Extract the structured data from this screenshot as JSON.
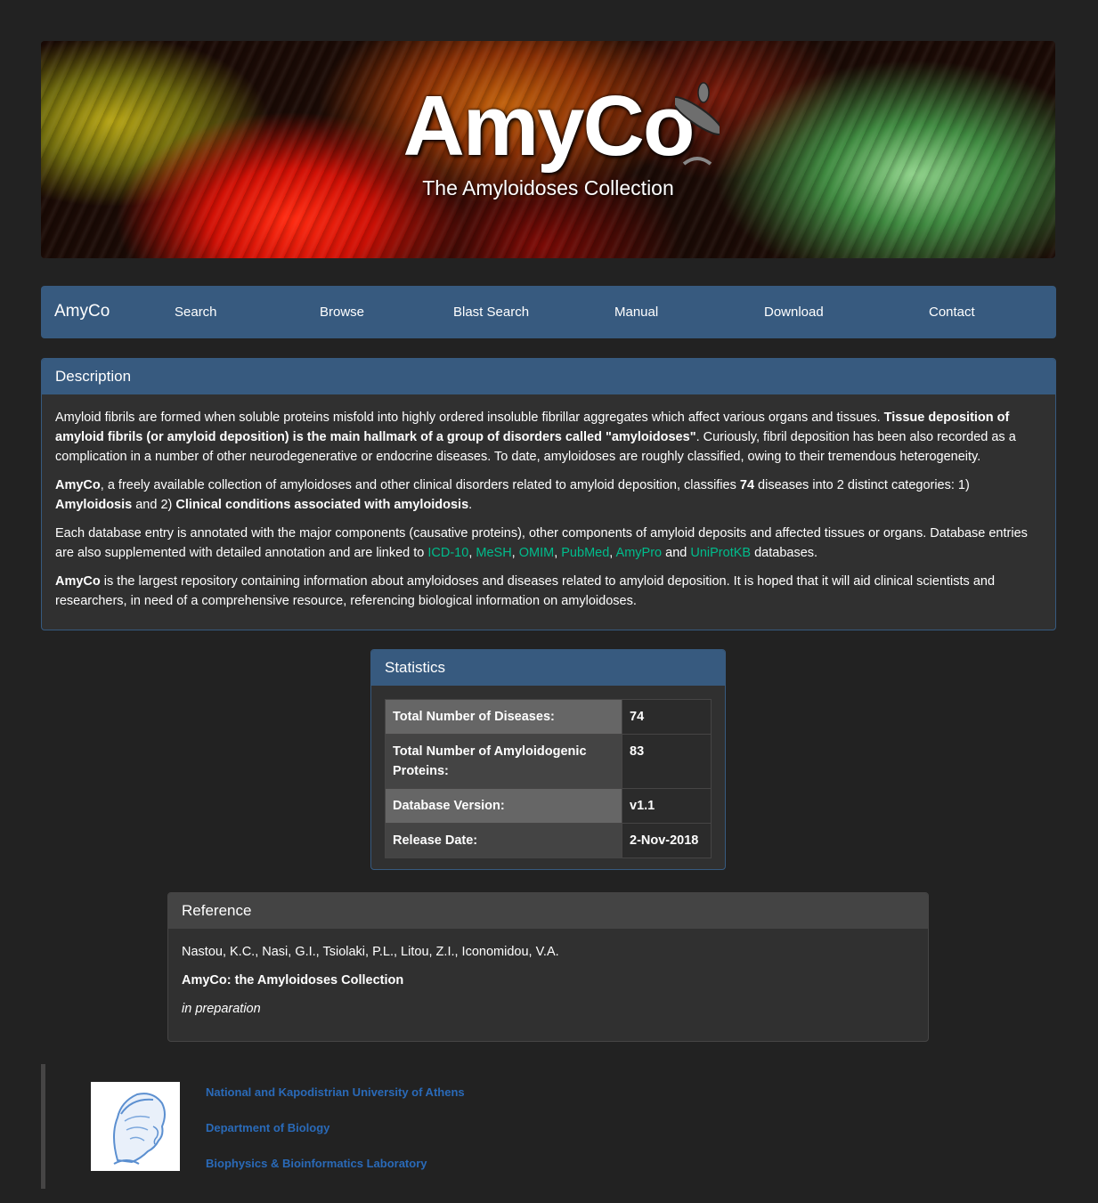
{
  "banner": {
    "title": "AmyCo",
    "subtitle": "The Amyloidoses Collection"
  },
  "navbar": {
    "brand": "AmyCo",
    "items": [
      "Search",
      "Browse",
      "Blast Search",
      "Manual",
      "Download",
      "Contact"
    ]
  },
  "description": {
    "heading": "Description",
    "p1_a": "Amyloid fibrils are formed when soluble proteins misfold into highly ordered insoluble fibrillar aggregates which affect various organs and tissues. ",
    "p1_b": "Tissue deposition of amyloid fibrils (or amyloid deposition) is the main hallmark of a group of disorders called \"amyloidoses\"",
    "p1_c": ". Curiously, fibril deposition has been also recorded as a complication in a number of other neurodegenerative or endocrine diseases. To date, amyloidoses are roughly classified, owing to their tremendous heterogeneity.",
    "p2_a": "AmyCo",
    "p2_b": ", a freely available collection of amyloidoses and other clinical disorders related to amyloid deposition, classifies ",
    "p2_c": "74",
    "p2_d": " diseases into 2 distinct categories: 1) ",
    "p2_e": "Amyloidosis",
    "p2_f": " and 2) ",
    "p2_g": "Clinical conditions associated with amyloidosis",
    "p2_h": ".",
    "p3_a": "Each database entry is annotated with the major components (causative proteins), other components of amyloid deposits and affected tissues or organs. Database entries are also supplemented with detailed annotation and are linked to ",
    "links": [
      "ICD-10",
      "MeSH",
      "OMIM",
      "PubMed",
      "AmyPro",
      "UniProtKB"
    ],
    "sep_comma": ", ",
    "sep_and": " and ",
    "p3_end": " databases.",
    "p4_a": "AmyCo",
    "p4_b": " is the largest repository containing information about amyloidoses and diseases related to amyloid deposition. It is hoped that it will aid clinical scientists and researchers, in need of a comprehensive resource, referencing biological information on amyloidoses."
  },
  "statistics": {
    "heading": "Statistics",
    "rows": [
      {
        "label": "Total Number of Diseases:",
        "value": "74"
      },
      {
        "label": "Total Number of Amyloidogenic Proteins:",
        "value": "83"
      },
      {
        "label": "Database Version:",
        "value": "v1.1"
      },
      {
        "label": "Release Date:",
        "value": "2-Nov-2018"
      }
    ]
  },
  "reference": {
    "heading": "Reference",
    "authors": "Nastou, K.C., Nasi, G.I., Tsiolaki, P.L., Litou, Z.I., Iconomidou, V.A.",
    "title": "AmyCo: the Amyloidoses Collection",
    "status": "in preparation"
  },
  "footer": {
    "links": [
      "National and Kapodistrian University of Athens",
      "Department of Biology",
      "Biophysics & Bioinformatics Laboratory"
    ],
    "logo_icon": "athena-head-logo"
  },
  "colors": {
    "background": "#222222",
    "panel_primary": "#375a7f",
    "link_green": "#00bc8c",
    "footer_link": "#2a6ab8"
  }
}
